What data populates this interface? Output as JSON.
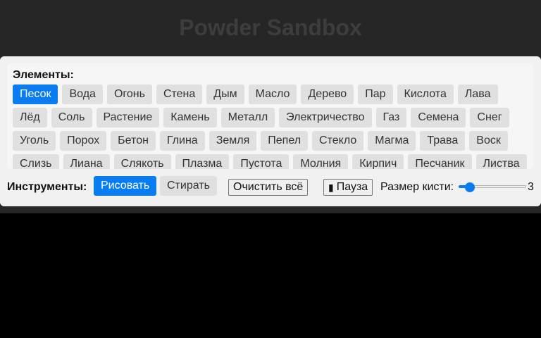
{
  "app": {
    "title": "Powder Sandbox"
  },
  "elements": {
    "heading": "Элементы:",
    "selected": "Песок",
    "rows": [
      [
        "Песок",
        "Вода",
        "Огонь",
        "Стена",
        "Дым",
        "Масло",
        "Дерево",
        "Пар",
        "Кислота",
        "Лава"
      ],
      [
        "Лёд",
        "Соль",
        "Растение",
        "Камень",
        "Металл",
        "Электричество",
        "Газ",
        "Семена",
        "Снег"
      ],
      [
        "Уголь",
        "Порох",
        "Бетон",
        "Глина",
        "Земля",
        "Пепел",
        "Стекло",
        "Магма",
        "Трава",
        "Воск"
      ],
      [
        "Слизь",
        "Лиана",
        "Слякоть",
        "Плазма",
        "Пустота",
        "Молния",
        "Кирпич",
        "Песчаник",
        "Листва"
      ]
    ]
  },
  "tools": {
    "label": "Инструменты:",
    "draw": "Рисовать",
    "erase": "Стирать",
    "active": "draw",
    "clear_all": "Очистить всё",
    "pause": "Пауза",
    "pause_icon": "pause-icon",
    "brush_label": "Размер кисти:",
    "brush_size": 3,
    "brush_min": 1,
    "brush_max": 20
  },
  "colors": {
    "accent": "#0a7cf2",
    "top_band": "#262626",
    "panel": "#f1f1f1",
    "button": "#e0e0e0",
    "background": "#000000"
  }
}
